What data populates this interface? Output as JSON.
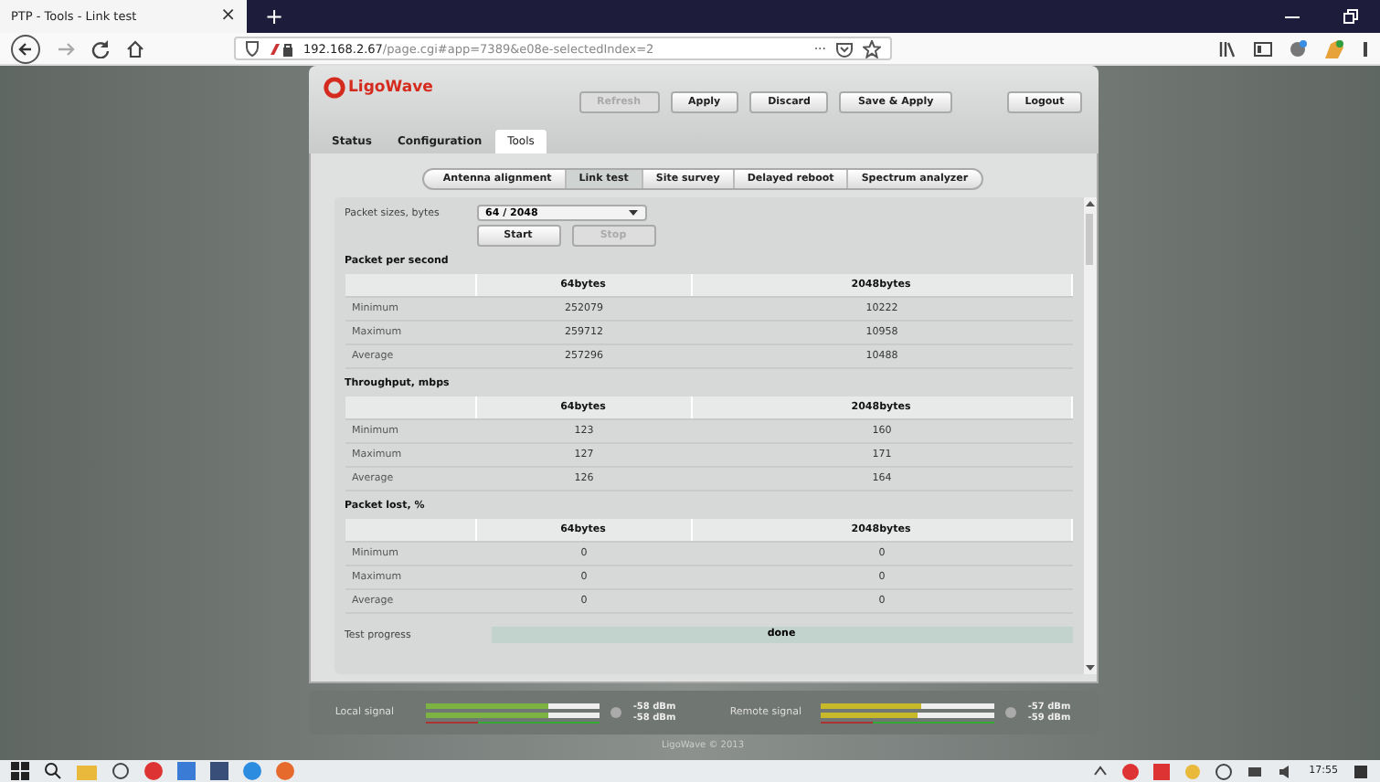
{
  "browser": {
    "tab_title": "PTP - Tools - Link test",
    "tab_close": "×",
    "new_tab": "+",
    "url_host": "192.168.2.67",
    "url_path": "/page.cgi#app=7389&e08e-selectedIndex=2",
    "page_actions": "···"
  },
  "app": {
    "logo": "LigoWave",
    "main_tabs": [
      {
        "label": "Status",
        "selected": false
      },
      {
        "label": "Configuration",
        "selected": false
      },
      {
        "label": "Tools",
        "selected": true
      }
    ],
    "actions": [
      {
        "label": "Refresh",
        "disabled": true
      },
      {
        "label": "Apply",
        "disabled": false
      },
      {
        "label": "Discard",
        "disabled": false
      },
      {
        "label": "Save & Apply",
        "disabled": false
      }
    ],
    "logout": "Logout",
    "sub_tabs": [
      {
        "label": "Antenna alignment",
        "selected": false
      },
      {
        "label": "Link test",
        "selected": true
      },
      {
        "label": "Site survey",
        "selected": false
      },
      {
        "label": "Delayed reboot",
        "selected": false
      },
      {
        "label": "Spectrum analyzer",
        "selected": false
      }
    ],
    "packet_size": {
      "label": "Packet sizes, bytes",
      "value": "64 / 2048"
    },
    "controls": [
      {
        "label": "Start",
        "disabled": false
      },
      {
        "label": "Stop",
        "disabled": true
      }
    ],
    "tables": [
      {
        "title": "Packet per second",
        "columns": [
          "64bytes",
          "2048bytes"
        ],
        "rows": [
          {
            "label": "Minimum",
            "values": [
              "252079",
              "10222"
            ]
          },
          {
            "label": "Maximum",
            "values": [
              "259712",
              "10958"
            ]
          },
          {
            "label": "Average",
            "values": [
              "257296",
              "10488"
            ]
          }
        ]
      },
      {
        "title": "Throughput, mbps",
        "columns": [
          "64bytes",
          "2048bytes"
        ],
        "rows": [
          {
            "label": "Minimum",
            "values": [
              "123",
              "160"
            ]
          },
          {
            "label": "Maximum",
            "values": [
              "127",
              "171"
            ]
          },
          {
            "label": "Average",
            "values": [
              "126",
              "164"
            ]
          }
        ]
      },
      {
        "title": "Packet lost, %",
        "columns": [
          "64bytes",
          "2048bytes"
        ],
        "rows": [
          {
            "label": "Minimum",
            "values": [
              "0",
              "0"
            ]
          },
          {
            "label": "Maximum",
            "values": [
              "0",
              "0"
            ]
          },
          {
            "label": "Average",
            "values": [
              "0",
              "0"
            ]
          }
        ]
      }
    ],
    "progress": {
      "label": "Test progress",
      "status": "done",
      "level": 1
    },
    "signals": [
      {
        "label": "Local signal",
        "color": "#7cb342",
        "bars": [
          {
            "level": 0.7,
            "reading": "-58 dBm"
          },
          {
            "level": 0.7,
            "reading": "-58 dBm"
          }
        ]
      },
      {
        "label": "Remote signal",
        "color": "#c8b92a",
        "bars": [
          {
            "level": 0.58,
            "reading": "-57 dBm"
          },
          {
            "level": 0.55,
            "reading": "-59 dBm"
          }
        ]
      }
    ],
    "footer": "LigoWave © 2013"
  },
  "taskbar": {
    "time": "17:55"
  }
}
